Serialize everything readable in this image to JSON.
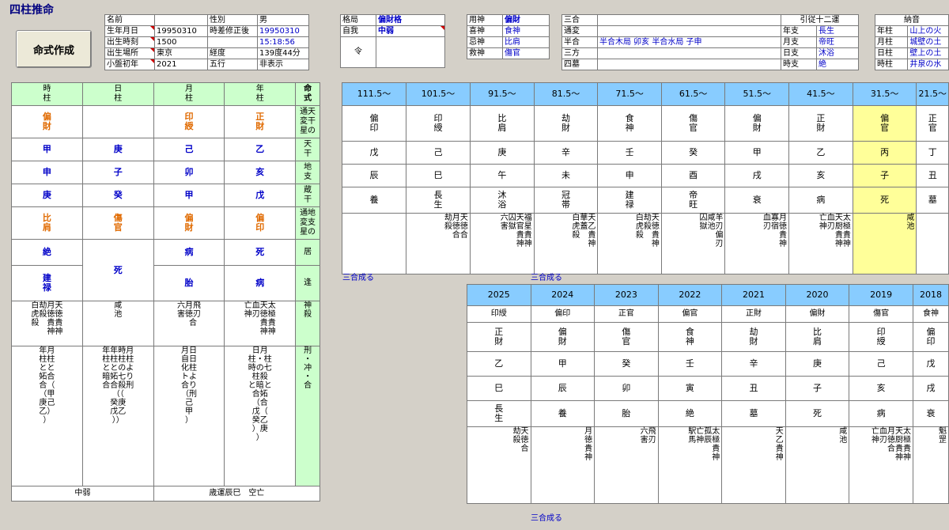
{
  "app": {
    "title": "四柱推命",
    "make_button": "命式作成"
  },
  "profile": {
    "rows": [
      [
        "名前",
        "",
        "性別",
        "男"
      ],
      [
        "生年月日",
        "19950310",
        "時差修正後",
        "19950310"
      ],
      [
        "出生時刻",
        "1500",
        "",
        "15:18:56"
      ],
      [
        "出生場所",
        "東京",
        "経度",
        "139度44分"
      ],
      [
        "小盤初年",
        "2021",
        "五行",
        "非表示"
      ]
    ]
  },
  "kakkyoku": {
    "rows": [
      [
        "格局",
        "偏財格"
      ],
      [
        "自我",
        "中弱"
      ],
      [
        "令",
        ""
      ]
    ]
  },
  "yojin": {
    "rows": [
      [
        "用神",
        "偏財"
      ],
      [
        "喜神",
        "食神"
      ],
      [
        "忌神",
        "比肩"
      ],
      [
        "救神",
        "傷官"
      ]
    ]
  },
  "sango": {
    "rows": [
      [
        "三合",
        ""
      ],
      [
        "通変",
        ""
      ],
      [
        "半合",
        "半合木局 卯亥 半合水局 子申"
      ],
      [
        "三方",
        ""
      ],
      [
        "四墓",
        ""
      ]
    ]
  },
  "junishi": {
    "header": "引従十二運",
    "rows": [
      [
        "年支",
        "長生"
      ],
      [
        "月支",
        "帝旺"
      ],
      [
        "日支",
        "沐浴"
      ],
      [
        "時支",
        "絶"
      ]
    ]
  },
  "nacchin": {
    "header": "納音",
    "rows": [
      [
        "年柱",
        "山上の火"
      ],
      [
        "月柱",
        "城壁の土"
      ],
      [
        "日柱",
        "壁上の土"
      ],
      [
        "時柱",
        "井泉の水"
      ]
    ]
  },
  "pillars": {
    "headers": [
      "時\n柱",
      "日\n柱",
      "月\n柱",
      "年\n柱"
    ],
    "side_header": "命\n式",
    "tsuhen_top": [
      "偏\n財",
      "",
      "印\n綬",
      "正\n財"
    ],
    "tenkan": [
      "甲",
      "庚",
      "己",
      "乙"
    ],
    "chishi": [
      "申",
      "子",
      "卯",
      "亥"
    ],
    "zokan": [
      "庚",
      "癸",
      "甲",
      "戊"
    ],
    "tsuhen_bottom": [
      "比\n肩",
      "傷\n官",
      "偏\n財",
      "偏\n印"
    ],
    "kyo": [
      "絶",
      "死",
      "病",
      "死"
    ],
    "to": [
      "建\n禄",
      "",
      "胎",
      "病"
    ],
    "shinsatsu": [
      "白劫月天\n虎殺徳徳\n殺　貴貴\n　　神神",
      "咸\n池",
      "六月飛\n害徳刃\n　合",
      "亡血天太\n神刃徳極\n　　貴貴\n　　神神"
    ],
    "keichu": [
      "年月\n柱柱\nとと\n妬合\n合（\n（甲\n庚己\n乙）\n）",
      "年年時月\n柱柱柱柱\nととのよ\n暗妬七り\n合合殺刑\n（（\n癸庚\n戊乙\n））",
      "月日\n自日\n化柱\nトよ\n合り\n（刑\n己\n甲\n）",
      "日月\n柱・柱\n時の七\n柱殺\nと暗と\n合妬\n（合\n戊（\n癸乙\n）庚\n）"
    ],
    "side_labels": [
      "通天\n変干\n星の",
      "天\n干",
      "地\n支",
      "蔵\n干",
      "通地\n変支\n星の",
      "居",
      "逢",
      "神\n殺",
      "刑\n・\n冲\n・\n合"
    ],
    "footer": [
      "中弱",
      "歳運辰巳　空亡"
    ]
  },
  "daiun": {
    "ages": [
      "111.5〜",
      "101.5〜",
      "91.5〜",
      "81.5〜",
      "71.5〜",
      "61.5〜",
      "51.5〜",
      "41.5〜",
      "31.5〜",
      "21.5〜"
    ],
    "tsuhen": [
      "偏\n印",
      "印\n綬",
      "比\n肩",
      "劫\n財",
      "食\n神",
      "傷\n官",
      "偏\n財",
      "正\n財",
      "偏\n官",
      "正\n官"
    ],
    "kan": [
      "戊",
      "己",
      "庚",
      "辛",
      "壬",
      "癸",
      "甲",
      "乙",
      "丙",
      "丁"
    ],
    "shi": [
      "辰",
      "巳",
      "午",
      "未",
      "申",
      "酉",
      "戌",
      "亥",
      "子",
      "丑"
    ],
    "unsei": [
      "養",
      "長\n生",
      "沐\n浴",
      "冠\n帯",
      "建\n禄",
      "帝\n旺",
      "衰",
      "病",
      "死",
      "墓"
    ],
    "shinsatsu": [
      "",
      "劫月天\n殺徳徳\n　合合",
      "六囚天福\n害獄官星\n　　貴貴\n　　神神",
      "白華天\n虎蓋乙\n殺　貴\n　　神",
      "白劫天\n虎殺徳\n殺　貴\n　　神",
      "囚咸羊\n獄池刃\n　　偏\n　　刃",
      "血寡月\n刃宿徳\n　　貴\n　　神",
      "亡血天太\n神刃厨極\n　　貴貴\n　　神神",
      "咸\n池",
      ""
    ],
    "link1": "三合成る",
    "link2": "三合成る"
  },
  "nenun": {
    "years": [
      "2025",
      "2024",
      "2023",
      "2022",
      "2021",
      "2020",
      "2019",
      "2018"
    ],
    "sub": [
      "印綬",
      "偏印",
      "正官",
      "偏官",
      "正財",
      "偏財",
      "傷官",
      "食神"
    ],
    "tsuhen": [
      "正\n財",
      "偏\n財",
      "傷\n官",
      "食\n神",
      "劫\n財",
      "比\n肩",
      "印\n綬",
      "偏\n印"
    ],
    "kan": [
      "乙",
      "甲",
      "癸",
      "壬",
      "辛",
      "庚",
      "己",
      "戊"
    ],
    "shi": [
      "巳",
      "辰",
      "卯",
      "寅",
      "丑",
      "子",
      "亥",
      "戌"
    ],
    "unsei": [
      "長\n生",
      "養",
      "胎",
      "絶",
      "墓",
      "死",
      "病",
      "衰"
    ],
    "shinsatsu": [
      "劫天\n殺徳\n　合",
      "月\n徳\n貴\n神",
      "六飛\n害刃",
      "駅亡孤太\n馬神辰極\n　　　貴\n　　　神",
      "天\n乙\n貴\n神",
      "咸\n池",
      "亡血月天太\n神刃徳厨極\n　　合貴貴\n　　　神神",
      "魁\n罡"
    ],
    "link": "三合成る"
  }
}
